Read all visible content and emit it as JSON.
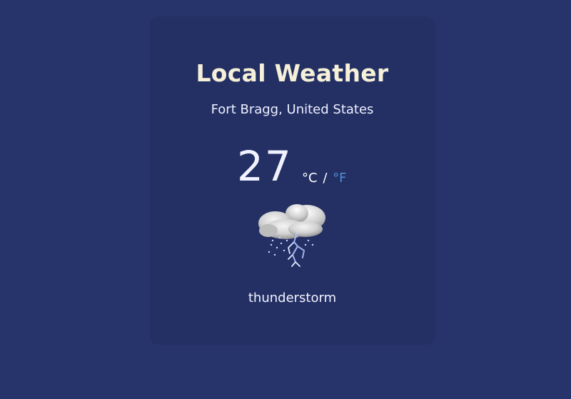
{
  "app": {
    "title": "Local Weather",
    "location": "Fort Bragg, United States"
  },
  "temperature": {
    "value": "27",
    "unit_c": "°C",
    "separator": "/",
    "unit_f": "°F"
  },
  "weather": {
    "condition": "thunderstorm",
    "icon": "thunderstorm-cloud-icon"
  },
  "colors": {
    "background": "#27336b",
    "card": "#243064",
    "title": "#f5f0d7",
    "link": "#4f8fd6"
  }
}
